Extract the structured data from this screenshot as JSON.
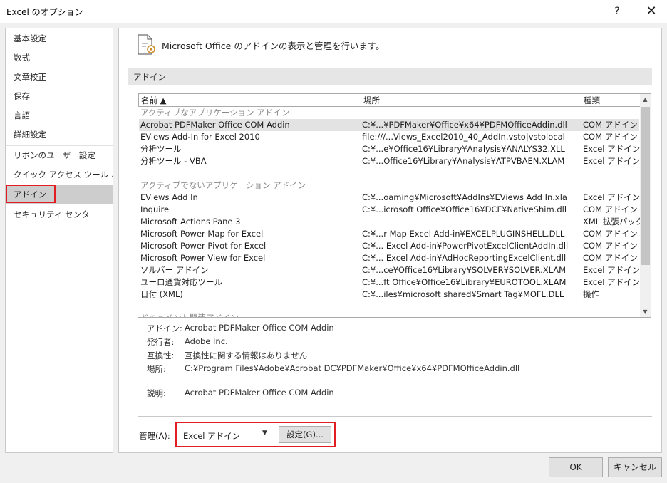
{
  "window": {
    "title": "Excel のオプション",
    "help": "?",
    "close": "✕"
  },
  "nav": {
    "items": [
      "基本設定",
      "数式",
      "文章校正",
      "保存",
      "言語",
      "詳細設定",
      "リボンのユーザー設定",
      "クイック アクセス ツール バー",
      "アドイン",
      "セキュリティ センター"
    ],
    "selected_index": 8
  },
  "header": {
    "text": "Microsoft Office のアドインの表示と管理を行います。"
  },
  "section": {
    "title": "アドイン"
  },
  "table": {
    "columns": [
      "名前 ▲",
      "場所",
      "種類"
    ],
    "groups": [
      {
        "label": "アクティブなアプリケーション アドイン",
        "rows": [
          [
            "Acrobat PDFMaker Office COM Addin",
            "C:¥...¥PDFMaker¥Office¥x64¥PDFMOfficeAddin.dll",
            "COM アドイン"
          ],
          [
            "EViews Add-In for Excel 2010",
            "file:///...Views_Excel2010_40_AddIn.vsto|vstolocal",
            "COM アドイン"
          ],
          [
            "分析ツール",
            "C:¥...e¥Office16¥Library¥Analysis¥ANALYS32.XLL",
            "Excel アドイン"
          ],
          [
            "分析ツール - VBA",
            "C:¥...Office16¥Library¥Analysis¥ATPVBAEN.XLAM",
            "Excel アドイン"
          ]
        ]
      },
      {
        "label": "アクティブでないアプリケーション アドイン",
        "rows": [
          [
            "EViews Add In",
            "C:¥...oaming¥Microsoft¥AddIns¥EViews Add In.xla",
            "Excel アドイン"
          ],
          [
            "Inquire",
            "C:¥...icrosoft Office¥Office16¥DCF¥NativeShim.dll",
            "COM アドイン"
          ],
          [
            "Microsoft Actions Pane 3",
            "",
            "XML 拡張パック"
          ],
          [
            "Microsoft Power Map for Excel",
            "C:¥...r Map Excel Add-in¥EXCELPLUGINSHELL.DLL",
            "COM アドイン"
          ],
          [
            "Microsoft Power Pivot for Excel",
            "C:¥... Excel Add-in¥PowerPivotExcelClientAddIn.dll",
            "COM アドイン"
          ],
          [
            "Microsoft Power View for Excel",
            "C:¥... Excel Add-in¥AdHocReportingExcelClient.dll",
            "COM アドイン"
          ],
          [
            "ソルバー アドイン",
            "C:¥...ce¥Office16¥Library¥SOLVER¥SOLVER.XLAM",
            "Excel アドイン"
          ],
          [
            "ユーロ通貨対応ツール",
            "C:¥...ft Office¥Office16¥Library¥EUROTOOL.XLAM",
            "Excel アドイン"
          ],
          [
            "日付 (XML)",
            "C:¥...iles¥microsoft shared¥Smart Tag¥MOFL.DLL",
            "操作"
          ]
        ]
      },
      {
        "label": "ドキュメント関連アドイン",
        "rows": []
      }
    ],
    "selected_row": "Acrobat PDFMaker Office COM Addin"
  },
  "details": {
    "addin_label": "アドイン:",
    "addin": "Acrobat PDFMaker Office COM Addin",
    "publisher_label": "発行者:",
    "publisher": "Adobe Inc.",
    "compat_label": "互換性:",
    "compat": "互換性に関する情報はありません",
    "location_label": "場所:",
    "location": "C:¥Program Files¥Adobe¥Acrobat DC¥PDFMaker¥Office¥x64¥PDFMOfficeAddin.dll",
    "desc_label": "説明:",
    "desc": "Acrobat PDFMaker Office COM Addin"
  },
  "manage": {
    "label": "管理(A):",
    "selected": "Excel アドイン",
    "go_label": "設定(G)..."
  },
  "footer": {
    "ok": "OK",
    "cancel": "キャンセル"
  },
  "colors": {
    "highlight": "#e21d22",
    "selected_nav": "#cdcdcd"
  }
}
